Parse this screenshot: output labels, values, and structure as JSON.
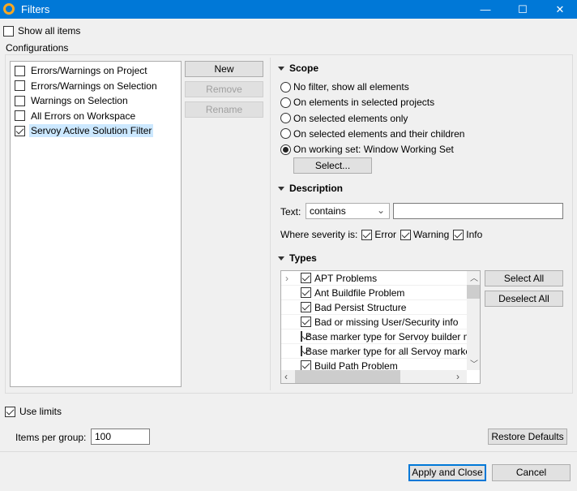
{
  "window": {
    "title": "Filters",
    "minimize": "—",
    "maximize": "☐",
    "close": "✕"
  },
  "show_all": {
    "label": "Show all items",
    "checked": false
  },
  "configurations": {
    "label": "Configurations",
    "items": [
      {
        "label": "Errors/Warnings on Project",
        "checked": false
      },
      {
        "label": "Errors/Warnings on Selection",
        "checked": false
      },
      {
        "label": "Warnings on Selection",
        "checked": false
      },
      {
        "label": "All Errors on Workspace",
        "checked": false
      },
      {
        "label": "Servoy Active Solution Filter",
        "checked": true,
        "selected": true
      }
    ],
    "buttons": {
      "new": "New",
      "remove": "Remove",
      "rename": "Rename"
    }
  },
  "scope": {
    "title": "Scope",
    "options": [
      "No filter, show all elements",
      "On elements in selected projects",
      "On selected elements only",
      "On selected elements and their children",
      "On working set:  Window Working Set"
    ],
    "selected_index": 4,
    "select_button": "Select..."
  },
  "description": {
    "title": "Description",
    "text_label": "Text:",
    "combo_value": "contains",
    "text_value": "",
    "severity_label": "Where severity is:",
    "severities": [
      {
        "label": "Error",
        "checked": true
      },
      {
        "label": "Warning",
        "checked": true
      },
      {
        "label": "Info",
        "checked": true
      }
    ]
  },
  "types": {
    "title": "Types",
    "items": [
      "APT Problems",
      "Ant Buildfile Problem",
      "Bad Persist Structure",
      "Bad or missing User/Security info",
      "Base marker type for Servoy builder m",
      "Base marker type for all Servoy marke",
      "Build Path Problem"
    ],
    "select_all": "Select All",
    "deselect_all": "Deselect All"
  },
  "limits": {
    "use_limits_label": "Use limits",
    "use_limits": true,
    "items_label": "Items per group:",
    "items_value": "100",
    "restore": "Restore Defaults"
  },
  "footer": {
    "apply": "Apply and Close",
    "cancel": "Cancel"
  }
}
